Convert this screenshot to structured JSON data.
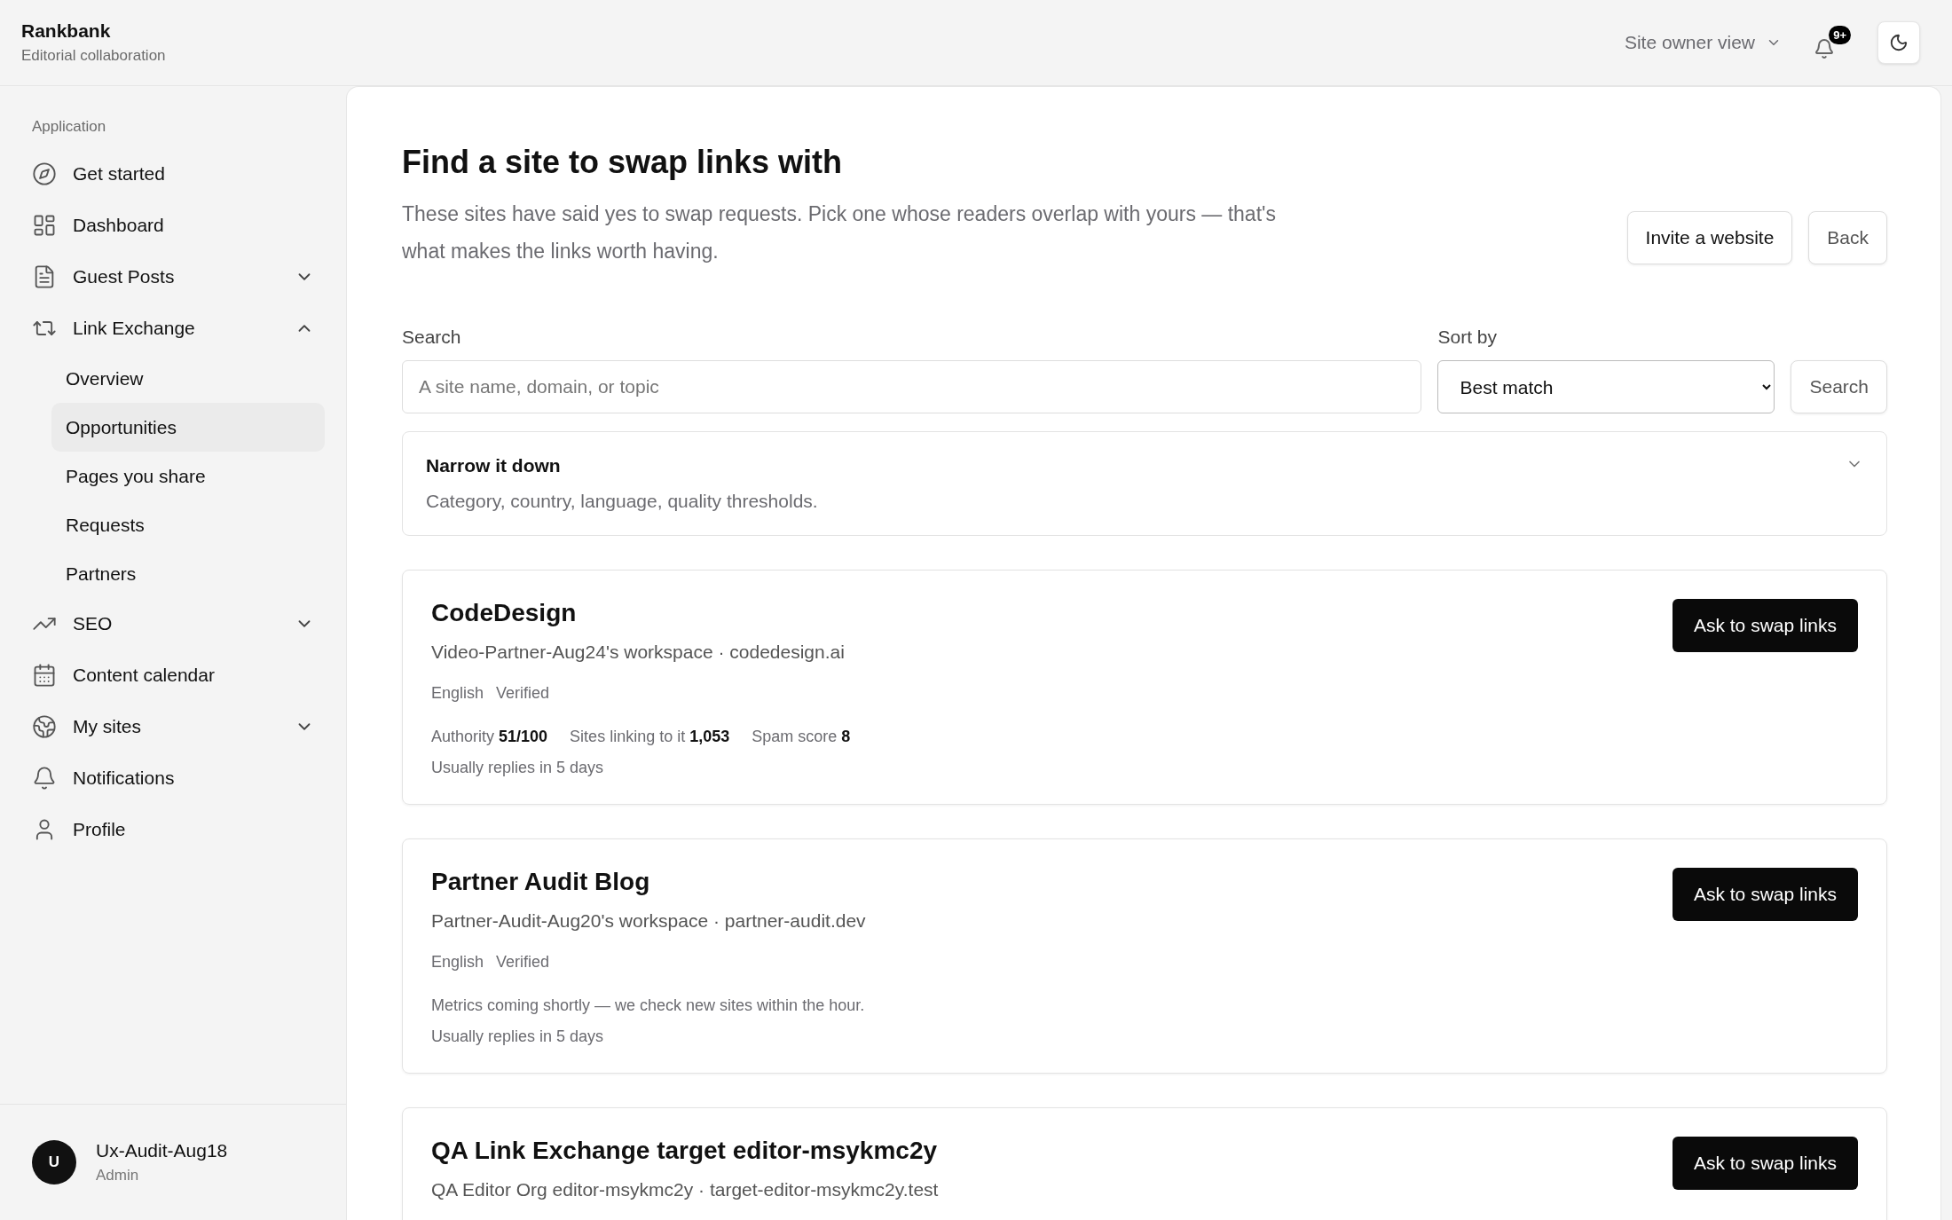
{
  "app": {
    "name": "Rankbank",
    "tagline": "Editorial collaboration"
  },
  "topbar": {
    "view_switch": "Site owner view",
    "view_menu_expanded": false,
    "notification_badge": "9+"
  },
  "sidebar": {
    "section_label": "Application",
    "items": [
      {
        "label": "Get started"
      },
      {
        "label": "Dashboard"
      },
      {
        "label": "Guest Posts",
        "expanded": false
      },
      {
        "label": "Link Exchange",
        "expanded": true,
        "children": [
          {
            "label": "Overview",
            "selected": false
          },
          {
            "label": "Opportunities",
            "selected": true
          },
          {
            "label": "Pages you share",
            "selected": false
          },
          {
            "label": "Requests",
            "selected": false
          },
          {
            "label": "Partners",
            "selected": false
          }
        ]
      },
      {
        "label": "SEO",
        "expanded": false
      },
      {
        "label": "Content calendar"
      },
      {
        "label": "My sites",
        "expanded": false
      },
      {
        "label": "Notifications"
      },
      {
        "label": "Profile"
      }
    ]
  },
  "user": {
    "initial": "U",
    "name": "Ux-Audit-Aug18",
    "role": "Admin"
  },
  "page": {
    "title": "Find a site to swap links with",
    "description": "These sites have said yes to swap requests. Pick one whose readers overlap with yours — that's what makes the links worth having.",
    "actions": [
      "Invite a website",
      "Back"
    ]
  },
  "search": {
    "label": "Search",
    "placeholder": "A site name, domain, or topic",
    "sort_label": "Sort by",
    "sort_value": "Best match",
    "button": "Search"
  },
  "filters": {
    "title": "Narrow it down",
    "subtitle": "Category, country, language, quality thresholds.",
    "expanded": false
  },
  "sites": [
    {
      "name": "CodeDesign",
      "owner_line": "Video-Partner-Aug24's workspace · codedesign.ai",
      "tags": [
        "English",
        "Verified"
      ],
      "metrics": [
        "Authority **51/100**",
        "Sites linking to it **1,053**",
        "Spam score **8**"
      ],
      "reply": "Usually replies in 5 days",
      "action": "Ask to swap links"
    },
    {
      "name": "Partner Audit Blog",
      "owner_line": "Partner-Audit-Aug20's workspace · partner-audit.dev",
      "tags": [
        "English",
        "Verified"
      ],
      "metrics_note": "Metrics coming shortly — we check new sites within the hour.",
      "reply": "Usually replies in 5 days",
      "action": "Ask to swap links"
    },
    {
      "name": "QA Link Exchange target editor-msykmc2y",
      "owner_line": "QA Editor Org editor-msykmc2y · target-editor-msykmc2y.test",
      "action": "Ask to swap links"
    }
  ]
}
